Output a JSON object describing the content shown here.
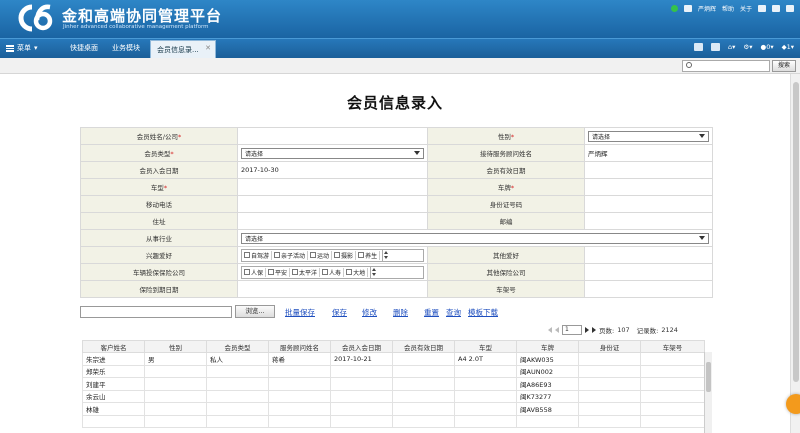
{
  "brand": {
    "name_cn": "金和高端协同管理平台",
    "name_en": "Jinher advanced collaborative management platform",
    "blue": "#1a64a3"
  },
  "header_right": {
    "user": "严炳辉",
    "help": "帮助",
    "about": "关于"
  },
  "tabbar": {
    "menu_label": "菜单",
    "tabs": [
      "快捷桌面",
      "业务模块"
    ],
    "active_tab": "会员信息录...",
    "msg_count": "0",
    "notice_count": "1"
  },
  "search": {
    "placeholder": "",
    "button": "搜索"
  },
  "page_title": "会员信息录入",
  "form": {
    "member_name": "会员姓名/公司",
    "gender": "性别",
    "gender_value": "请选择",
    "member_type": "会员类型",
    "member_type_value": "请选择",
    "consultant": "接待服务顾问姓名",
    "consultant_value": "严炳辉",
    "join_date": "会员入会日期",
    "join_date_value": "2017-10-30",
    "valid_date": "会员有效日期",
    "car_model": "车型",
    "plate": "车牌",
    "mobile": "移动电话",
    "id_no": "身份证号码",
    "address": "住址",
    "email": "邮编",
    "industry": "从事行业",
    "industry_value": "请选择",
    "hobby": "兴趣爱好",
    "hobby_options": [
      "自驾游",
      "亲子活动",
      "运动",
      "摄影",
      "养生"
    ],
    "other_hobby": "其他爱好",
    "insurer": "车辆投保保险公司",
    "insurer_options": [
      "人保",
      "平安",
      "太平洋",
      "人寿",
      "大地"
    ],
    "other_insurer": "其他保险公司",
    "insurance_expiry": "保险到期日期",
    "vin": "车架号"
  },
  "actions": {
    "browse": "浏览...",
    "batch_save": "批量保存",
    "save": "保存",
    "edit": "修改",
    "delete": "删除",
    "reset": "重置",
    "query": "查询",
    "template": "模板下载"
  },
  "pager": {
    "page": "1",
    "pages_label": "页数:",
    "pages": "107",
    "records_label": "记录数:",
    "records": "2124"
  },
  "grid": {
    "columns": [
      "客户姓名",
      "性别",
      "会员类型",
      "服务顾问姓名",
      "会员入会日期",
      "会员有效日期",
      "车型",
      "车牌",
      "身份证",
      "车架号"
    ],
    "rows": [
      [
        "朱宗进",
        "男",
        "私人",
        "蒋希",
        "2017-10-21",
        "",
        "A4 2.0T",
        "闽AKW035",
        "",
        ""
      ],
      [
        "郑荣乐",
        "",
        "",
        "",
        "",
        "",
        "",
        "闽AUN002",
        "",
        ""
      ],
      [
        "刘建平",
        "",
        "",
        "",
        "",
        "",
        "",
        "闽A86E93",
        "",
        ""
      ],
      [
        "余云山",
        "",
        "",
        "",
        "",
        "",
        "",
        "闽K73277",
        "",
        ""
      ],
      [
        "林雄",
        "",
        "",
        "",
        "",
        "",
        "",
        "闽AVB558",
        "",
        ""
      ],
      [
        "",
        "",
        "",
        "",
        "",
        "",
        "",
        "",
        "",
        ""
      ]
    ]
  }
}
